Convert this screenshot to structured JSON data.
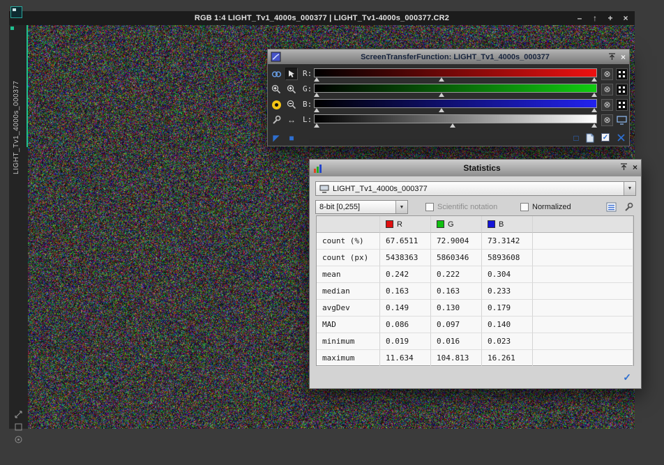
{
  "window": {
    "title": "RGB 1:4 LIGHT_Tv1_4000s_000377 | LIGHT_Tv1-4000s_000377.CR2",
    "tab_label": "LIGHT_Tv1_4000s_000377",
    "controls": {
      "minimize": "–",
      "shade": "↑",
      "zoom": "+",
      "close": "×"
    }
  },
  "stf": {
    "title": "ScreenTransferFunction: LIGHT_Tv1_4000s_000377",
    "close": "×",
    "channels": [
      {
        "label": "R:",
        "color": "#ee1111"
      },
      {
        "label": "G:",
        "color": "#11cc11"
      },
      {
        "label": "B:",
        "color": "#2222ee"
      },
      {
        "label": "L:",
        "color": "#ffffff"
      }
    ]
  },
  "statistics": {
    "title": "Statistics",
    "view_name": "LIGHT_Tv1_4000s_000377",
    "range": "8-bit [0,255]",
    "scientific_label": "Scientific notation",
    "normalized_label": "Normalized",
    "close": "×",
    "table": {
      "columns": [
        "R",
        "G",
        "B"
      ],
      "column_colors": [
        "#e01010",
        "#10c010",
        "#1515d8"
      ],
      "rows": [
        {
          "label": "count (%)",
          "values": [
            "67.6511",
            "72.9004",
            "73.3142"
          ]
        },
        {
          "label": "count (px)",
          "values": [
            "5438363",
            "5860346",
            "5893608"
          ]
        },
        {
          "label": "mean",
          "values": [
            "0.242",
            "0.222",
            "0.304"
          ]
        },
        {
          "label": "median",
          "values": [
            "0.163",
            "0.163",
            "0.233"
          ]
        },
        {
          "label": "avgDev",
          "values": [
            "0.149",
            "0.130",
            "0.179"
          ]
        },
        {
          "label": "MAD",
          "values": [
            "0.086",
            "0.097",
            "0.140"
          ]
        },
        {
          "label": "minimum",
          "values": [
            "0.019",
            "0.016",
            "0.023"
          ]
        },
        {
          "label": "maximum",
          "values": [
            "11.634",
            "104.813",
            "16.261"
          ]
        }
      ]
    }
  },
  "icons": {
    "reset_channel": "⊗",
    "pan_arrows": "↔",
    "combo_arrow": "▼",
    "check": "✓",
    "new_instance": "◤",
    "apply_square": "■",
    "square_outline": "□"
  },
  "colors": {
    "accent_blue": "#2e6fd0",
    "tab_accent": "#1fc08f"
  }
}
